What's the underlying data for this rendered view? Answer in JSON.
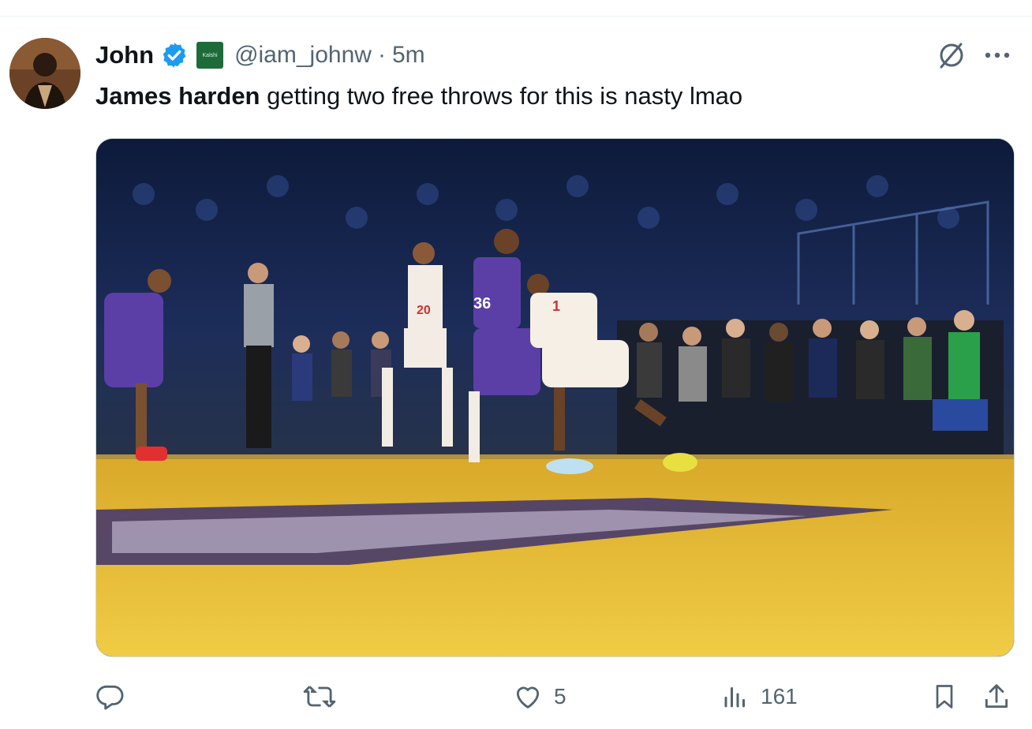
{
  "tweet": {
    "author_name": "John",
    "affiliate_badge_text": "Kalshi",
    "handle": "@iam_johnw",
    "separator": "·",
    "time": "5m",
    "text_bold": "James harden",
    "text_rest": " getting two free throws for this is nasty lmao"
  },
  "media": {
    "jersey_numbers": [
      "20",
      "1",
      "36"
    ]
  },
  "actions": {
    "reply_count": "",
    "retweet_count": "",
    "like_count": "5",
    "views_count": "161"
  },
  "colors": {
    "verified_blue": "#1d9bf0",
    "secondary_text": "#536471",
    "court_yellow": "#e6b92c",
    "lakers_purple": "#5b3fa6"
  },
  "icons": [
    "verified-icon",
    "grok-icon",
    "more-icon",
    "reply-icon",
    "retweet-icon",
    "like-icon",
    "views-icon",
    "bookmark-icon",
    "share-icon"
  ]
}
